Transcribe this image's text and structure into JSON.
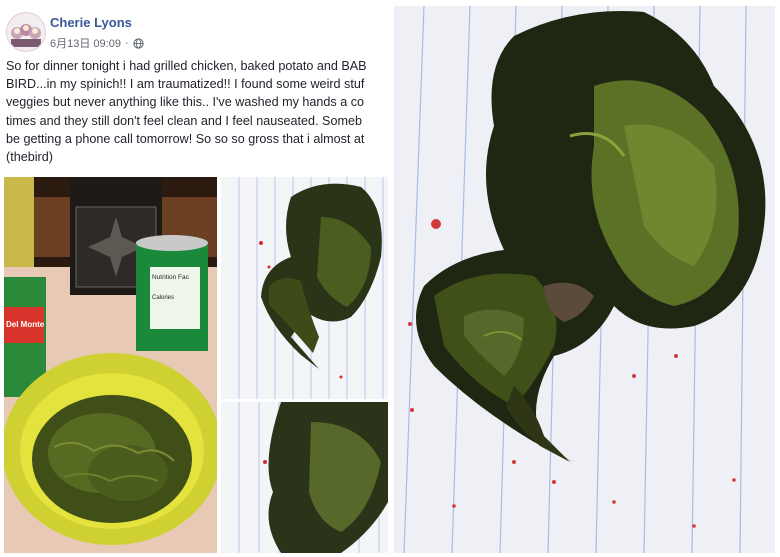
{
  "post": {
    "author": "Cherie Lyons",
    "date": "6月13日 09:09",
    "privacy_icon": "globe-icon",
    "text_lines": [
      "So for dinner tonight i had grilled chicken, baked potato and BAB",
      "BIRD...in my spinich!! I am traumatized!! I found some weird stuf",
      "veggies but never anything like this.. I've washed my hands a co",
      "times and they still don't feel clean and I feel nauseated. Someb",
      "be getting a phone call tomorrow! So so so gross that i almost at",
      "(thebird)"
    ]
  },
  "photos": {
    "can_label_brand": "Del Monte",
    "can_label_nutrition": "Nutrition Fac",
    "can_label_calories": "Calories"
  },
  "colors": {
    "author_blue": "#385898",
    "bowl_yellow": "#d6d62a",
    "spinach_green": "#4b5a1c"
  }
}
